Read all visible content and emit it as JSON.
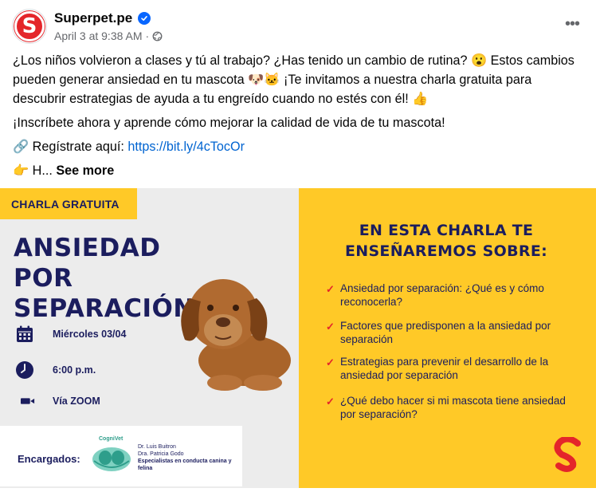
{
  "post": {
    "page_name": "Superpet.pe",
    "timestamp": "April 3 at 9:38 AM",
    "separator": "·",
    "avatar_letter": "S",
    "more_label": "•••",
    "text": {
      "p1_a": "¿Los niños volvieron a clases y tú al trabajo? ¿Has tenido un cambio de rutina? 😮 Estos cambios pueden generar ansiedad en tu mascota 🐶🐱 ¡Te invitamos a nuestra charla gratuita para descubrir estrategias de ayuda a tu engreído cuando no estés con él! 👍",
      "p2": "¡Inscríbete ahora y aprende cómo mejorar la calidad de vida de tu mascota!",
      "p3_prefix": "🔗 Regístrate aquí: ",
      "p3_link": "https://bit.ly/4cTocOr",
      "p4_prefix": "👉 H... ",
      "see_more": "See more"
    }
  },
  "banner": {
    "tag": "CHARLA GRATUITA",
    "headline_1": "ANSIEDAD POR",
    "headline_2": "SEPARACIÓN",
    "date": "Miércoles 03/04",
    "time": "6:00 p.m.",
    "platform": "Vía ZOOM",
    "encargados_label": "Encargados:",
    "cognivet": "CogniVet",
    "doctor_1": "Dr. Luis Buitron",
    "doctor_2": "Dra. Patricia Godo",
    "specialists": "Especialistas en conducta canina y felina",
    "right_title_1": "EN ESTA CHARLA TE",
    "right_title_2": "ENSEÑAREMOS SOBRE:",
    "topics": [
      "Ansiedad por separación: ¿Qué es y cómo reconocerla?",
      "Factores que predisponen a la ansiedad por separación",
      "Estrategias para prevenir el desarrollo de la ansiedad por separación",
      "¿Qué debo hacer si mi mascota tiene ansiedad por separación?"
    ]
  },
  "colors": {
    "brand_red": "#e4252a",
    "brand_yellow": "#ffc927",
    "navy": "#1b1d5e",
    "link": "#0064d1",
    "verified": "#0866ff"
  }
}
